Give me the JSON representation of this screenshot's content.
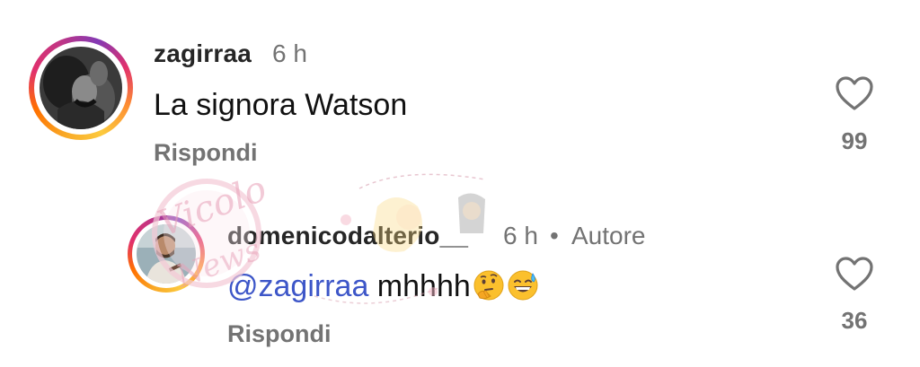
{
  "comments": [
    {
      "username": "zagirraa",
      "time": "6 h",
      "text": "La signora Watson",
      "reply_label": "Rispondi",
      "likes": "99"
    },
    {
      "username": "domenicodalterio__",
      "time": "6 h",
      "separator": "•",
      "author_badge": "Autore",
      "mention": "@zagirraa",
      "text": " mhhhh",
      "emojis": [
        "thinking-face-emoji",
        "grinning-sweat-emoji"
      ],
      "reply_label": "Rispondi",
      "likes": "36"
    }
  ],
  "watermark": {
    "text": "Vicolo delle News",
    "colors": [
      "#e8a0b8",
      "#f4c9d6"
    ]
  },
  "colors": {
    "mention": "#3d56c8",
    "secondary_text": "#737373",
    "heart_outline": "#737373"
  }
}
